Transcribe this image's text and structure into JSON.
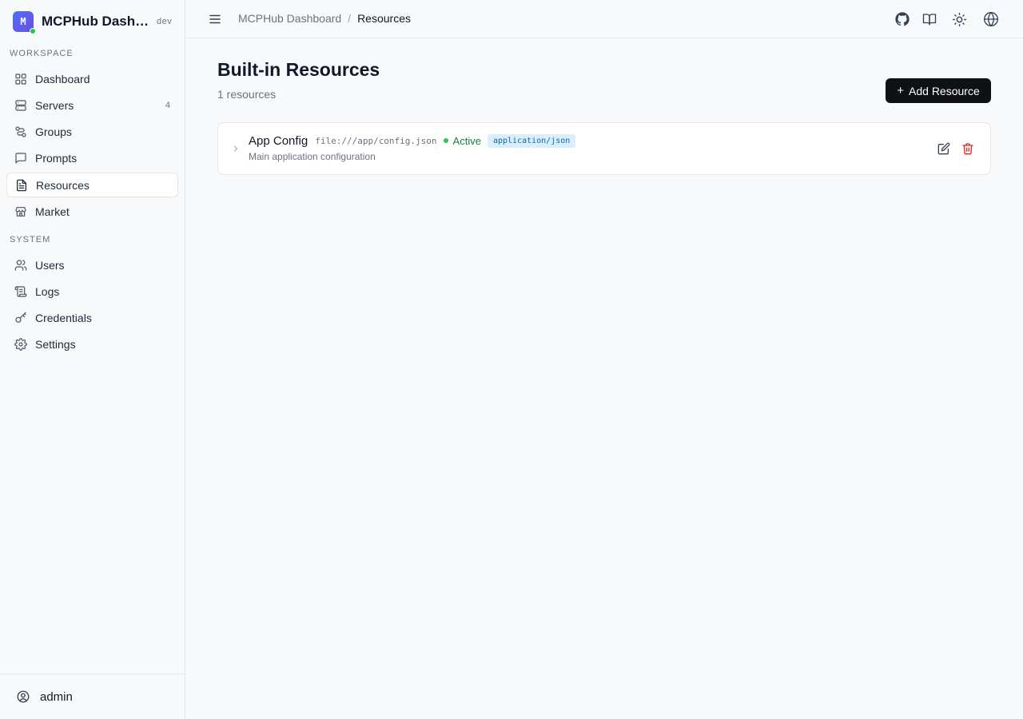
{
  "app": {
    "logo_letter": "M",
    "name": "MCPHub Dashboard",
    "env": "dev"
  },
  "sidebar": {
    "workspace_label": "Workspace",
    "system_label": "System",
    "workspace_items": [
      {
        "label": "Dashboard",
        "icon": "grid-icon"
      },
      {
        "label": "Servers",
        "icon": "server-icon",
        "count": "4"
      },
      {
        "label": "Groups",
        "icon": "groups-icon"
      },
      {
        "label": "Prompts",
        "icon": "message-icon"
      },
      {
        "label": "Resources",
        "icon": "file-text-icon",
        "active": true
      },
      {
        "label": "Market",
        "icon": "store-icon"
      }
    ],
    "system_items": [
      {
        "label": "Users",
        "icon": "users-icon"
      },
      {
        "label": "Logs",
        "icon": "scroll-icon"
      },
      {
        "label": "Credentials",
        "icon": "key-icon"
      },
      {
        "label": "Settings",
        "icon": "gear-icon"
      }
    ],
    "user": {
      "name": "admin",
      "icon": "user-icon"
    }
  },
  "header": {
    "breadcrumb_root": "MCPHub Dashboard",
    "breadcrumb_sep": "/",
    "breadcrumb_current": "Resources",
    "icons": [
      "github-icon",
      "book-icon",
      "sun-icon",
      "globe-icon"
    ]
  },
  "main": {
    "title": "Built-in Resources",
    "subtitle": "1 resources",
    "add_button_label": "Add Resource",
    "resources": [
      {
        "name": "App Config",
        "uri": "file:///app/config.json",
        "status": "Active",
        "mime_type": "application/json",
        "description": "Main application configuration"
      }
    ]
  },
  "colors": {
    "accent": "#0f1115",
    "active_status": "#15803d",
    "delete": "#dc2626",
    "mime_badge_bg": "#dbeefb"
  }
}
